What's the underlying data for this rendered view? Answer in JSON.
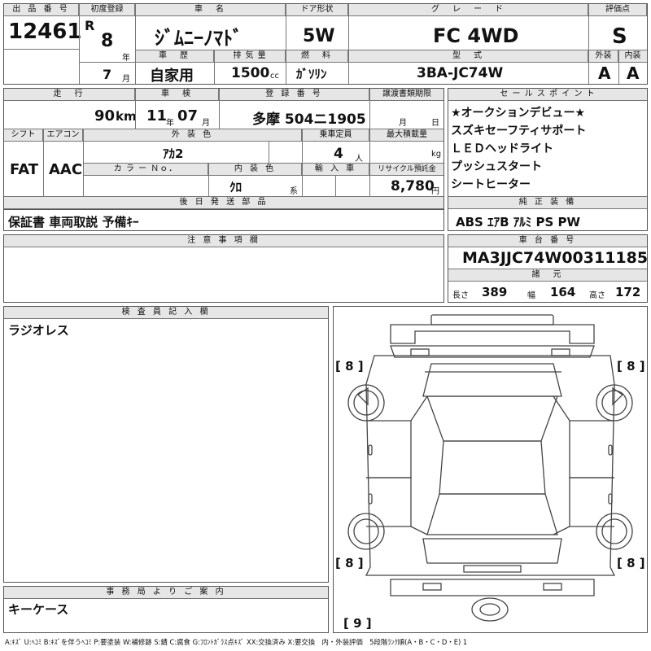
{
  "lot": {
    "label": "出 品 番 号",
    "value": "12461"
  },
  "reg_first": {
    "label": "初度登録",
    "era": "R",
    "year": "8",
    "year_unit": "年",
    "month": "7",
    "month_unit": "月"
  },
  "car_name": {
    "label": "車　名",
    "value": "ｼﾞﾑﾆｰﾉﾏﾄﾞ"
  },
  "doors": {
    "label": "ドア形状",
    "value": "5W"
  },
  "grade": {
    "label": "グ　レ　ー　ド",
    "value": "FC 4WD"
  },
  "score": {
    "label": "評価点",
    "value": "S"
  },
  "history": {
    "label": "車　歴",
    "value": "自家用"
  },
  "displacement": {
    "label": "排 気 量",
    "value": "1500",
    "unit": "cc"
  },
  "fuel": {
    "label": "燃　料",
    "value": "ｶﾞｿﾘﾝ"
  },
  "model": {
    "label": "型　式",
    "value": "3BA-JC74W"
  },
  "exterior_grade": {
    "label": "外装",
    "value": "A"
  },
  "interior_grade": {
    "label": "内装",
    "value": "A"
  },
  "mileage": {
    "label": "走　行",
    "value": "90",
    "unit": "km"
  },
  "inspection": {
    "label": "車　検",
    "year": "11",
    "year_unit": "年",
    "month": "07",
    "month_unit": "月"
  },
  "plate": {
    "label": "登 録 番 号",
    "value": "多摩 504ニ1905"
  },
  "transfer": {
    "label": "譲渡書類期限",
    "month_unit": "月",
    "day_unit": "日"
  },
  "shift": {
    "label": "シフト",
    "value": "FAT"
  },
  "aircon": {
    "label": "エアコン",
    "value": "AAC"
  },
  "ext_color": {
    "label": "外 装 色",
    "value": "ｱｶ2"
  },
  "capacity": {
    "label": "乗車定員",
    "value": "4",
    "unit": "人"
  },
  "max_load": {
    "label": "最大積載量",
    "unit": "kg"
  },
  "color_no": {
    "label": "カ ラ ー Ｎｏ．"
  },
  "int_color": {
    "label": "内 装 色",
    "value": "ｸﾛ",
    "suffix": "系"
  },
  "import": {
    "label": "輸 入 車"
  },
  "recycle": {
    "label": "リサイクル預託金",
    "value": "8,780",
    "unit": "円"
  },
  "selling_points": {
    "label": "セ ー ル ス ポ イ ン ト",
    "items": [
      "★オークションデビュー★",
      "スズキセーフティサポート",
      "ＬＥＤヘッドライト",
      "プッシュスタート",
      "シートヒーター"
    ]
  },
  "parts": {
    "label": "後 日 発 送 部 品",
    "value": "保証書 車両取説 予備ｷｰ"
  },
  "equipment": {
    "label": "純 正 装 備",
    "value": "ABS ｴｱB ｱﾙﾐ PS PW"
  },
  "notes": {
    "label": "注 意 事 項 欄",
    "value": ""
  },
  "chassis": {
    "label": "車 台 番 号",
    "value": "MA3JJC74W00311185"
  },
  "dims": {
    "label": "諸　元",
    "length_label": "長さ",
    "length": "389",
    "width_label": "幅",
    "width": "164",
    "height_label": "高さ",
    "height": "172"
  },
  "inspector": {
    "label": "検 査 員 記 入 欄",
    "value": "ラジオレス"
  },
  "office": {
    "label": "事 務 局 よ り ご 案 内",
    "value": "キーケース"
  },
  "tires": {
    "fl": "[ 8 ]",
    "fr": "[ 8 ]",
    "rl": "[ 8 ]",
    "rr": "[ 8 ]",
    "spare": "[ 9 ]"
  },
  "legend": "A:ｷｽﾞ U:ﾍｺﾐ B:ｷｽﾞを伴うﾍｺﾐ P:要塗装 W:補修跡 S:錆 C:腐食 G:ﾌﾛﾝﾄｶﾞﾗｽ点ｷｽﾞ XX:交換済み X:要交換　内・外装評価　5段階ﾗﾝｸ順(A・B・C・D・E) 1"
}
